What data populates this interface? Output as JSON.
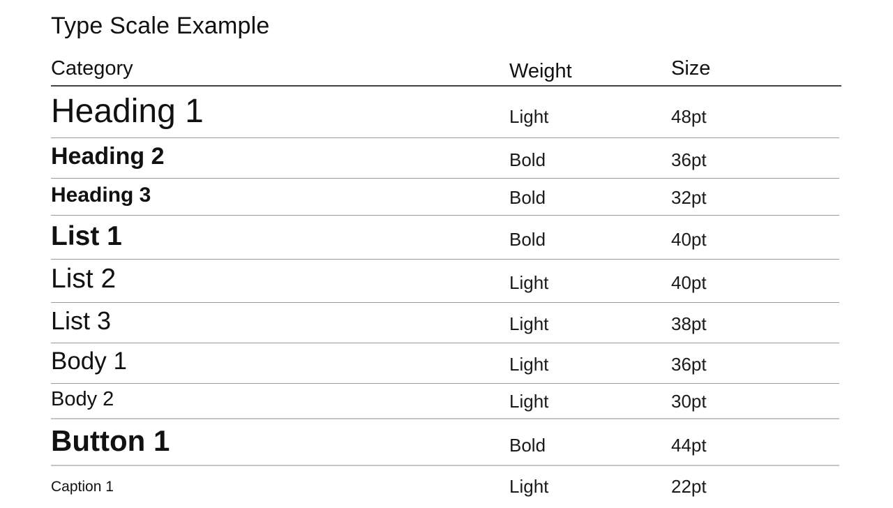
{
  "title": "Type Scale Example",
  "columns": {
    "category": "Category",
    "weight": "Weight",
    "size": "Size"
  },
  "rows": [
    {
      "category": "Heading 1",
      "weight": "Light",
      "size": "48pt"
    },
    {
      "category": "Heading 2",
      "weight": "Bold",
      "size": "36pt"
    },
    {
      "category": "Heading 3",
      "weight": "Bold",
      "size": "32pt"
    },
    {
      "category": "List 1",
      "weight": "Bold",
      "size": "40pt"
    },
    {
      "category": "List 2",
      "weight": "Light",
      "size": "40pt"
    },
    {
      "category": "List 3",
      "weight": "Light",
      "size": "38pt"
    },
    {
      "category": "Body 1",
      "weight": "Light",
      "size": "36pt"
    },
    {
      "category": "Body 2",
      "weight": "Light",
      "size": "30pt"
    },
    {
      "category": "Button 1",
      "weight": "Bold",
      "size": "44pt"
    },
    {
      "category": "Caption 1",
      "weight": "Light",
      "size": "22pt"
    }
  ]
}
